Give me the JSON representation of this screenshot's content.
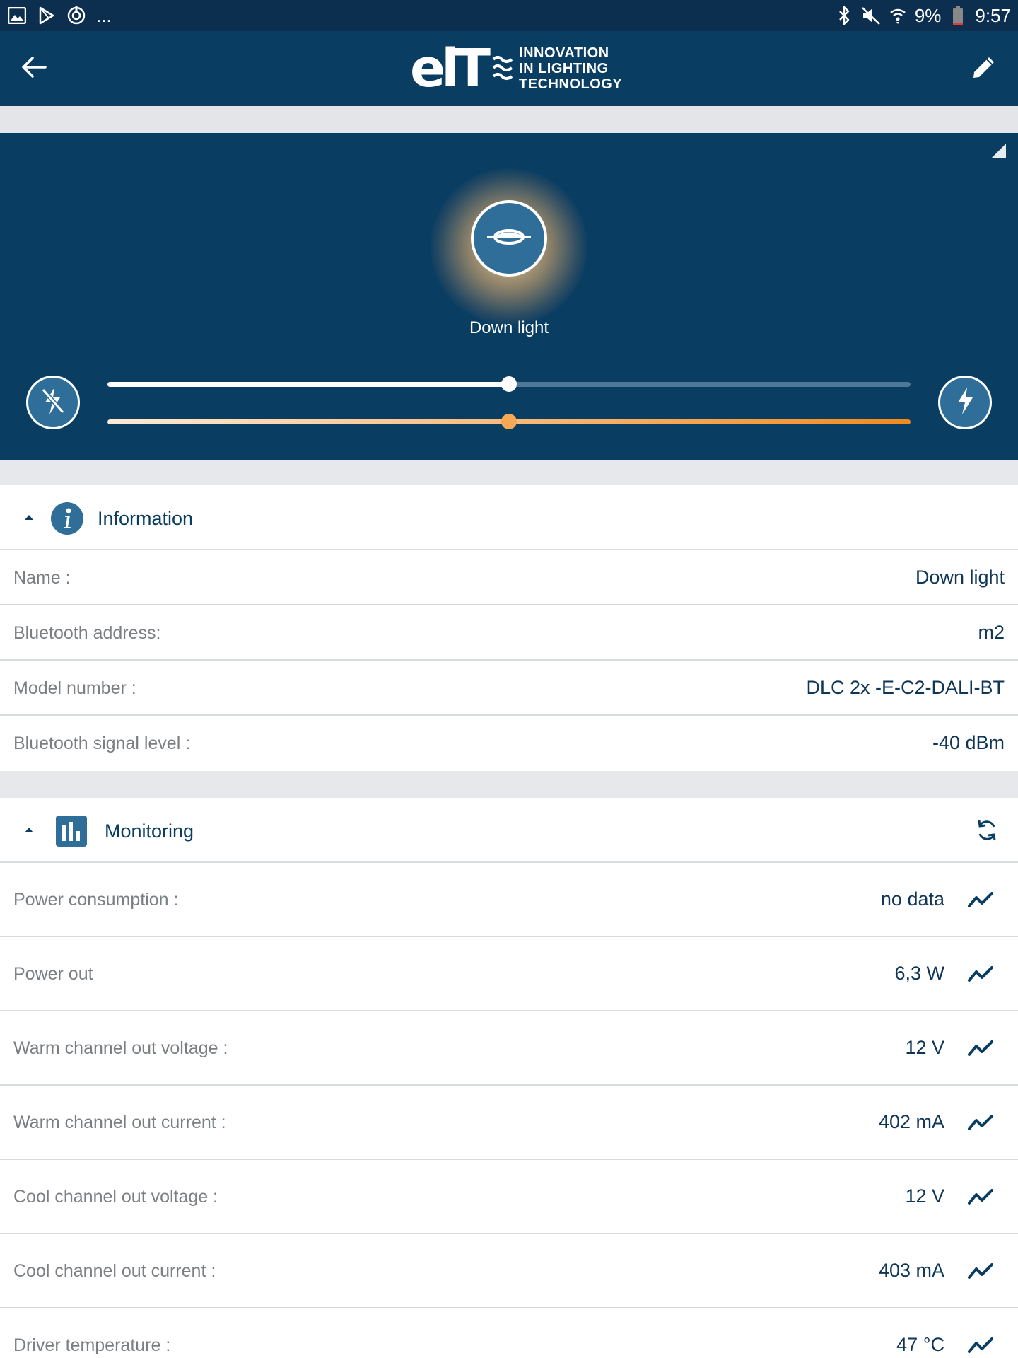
{
  "status_bar": {
    "left_icons": [
      "gallery-icon",
      "play-store-icon",
      "sync-icon"
    ],
    "overflow": "...",
    "right_icons": [
      "bluetooth-icon",
      "mute-icon",
      "wifi-icon"
    ],
    "battery": "9%",
    "time": "9:57"
  },
  "app_bar": {
    "back_icon": "arrow-back-icon",
    "edit_icon": "pencil-icon",
    "logo": {
      "mark": "elT",
      "line1": "INNOVATION",
      "line2": "IN LIGHTING",
      "line3": "TECHNOLOGY"
    }
  },
  "device_panel": {
    "device_name": "Down light",
    "lamp_icon": "downlight-icon",
    "power_off_icon": "flash-off-icon",
    "power_on_icon": "flash-on-icon",
    "brightness_level": 0.5,
    "color_temperature_level": 0.5,
    "colors": {
      "panel": "#0a3d62",
      "warm_start": "#fde9d4",
      "warm_end": "#f28a1e"
    }
  },
  "information": {
    "title": "Information",
    "icon": "info-icon",
    "rows": [
      {
        "label": "Name :",
        "value": "Down light"
      },
      {
        "label": "Bluetooth address:",
        "value": "m2"
      },
      {
        "label": "Model number :",
        "value": "DLC 2x -E-C2-DALI-BT"
      },
      {
        "label": "Bluetooth signal level :",
        "value": "-40 dBm"
      }
    ]
  },
  "monitoring": {
    "title": "Monitoring",
    "icon": "bar-chart-icon",
    "refresh_icon": "refresh-icon",
    "rows": [
      {
        "label": "Power consumption :",
        "value": "no data"
      },
      {
        "label": "Power out",
        "value": "6,3 W"
      },
      {
        "label": "Warm channel out voltage :",
        "value": "12 V"
      },
      {
        "label": "Warm channel out current :",
        "value": "402 mA"
      },
      {
        "label": "Cool channel out voltage :",
        "value": "12 V"
      },
      {
        "label": "Cool channel out current :",
        "value": "403 mA"
      },
      {
        "label": "Driver temperature :",
        "value": "47 °C"
      }
    ]
  }
}
